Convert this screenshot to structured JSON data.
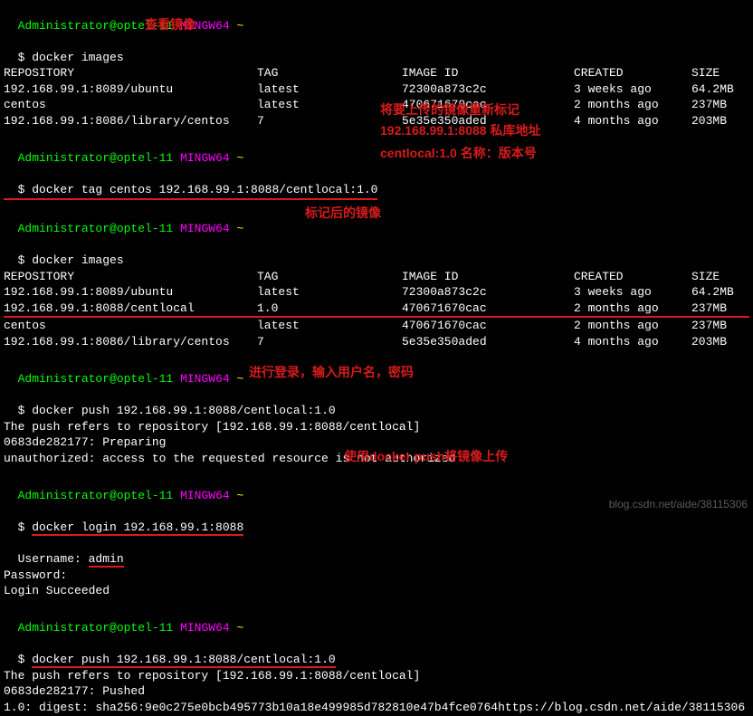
{
  "prompt": {
    "user_host": "Administrator@optel-11",
    "shell": "MINGW64",
    "cwd": "~",
    "symbol": "$ "
  },
  "cmd1": "docker images",
  "table1": {
    "headers": {
      "repo": "REPOSITORY",
      "tag": "TAG",
      "imgid": "IMAGE ID",
      "created": "CREATED",
      "size": "SIZE"
    },
    "rows": [
      {
        "repo": "192.168.99.1:8089/ubuntu",
        "tag": "latest",
        "imgid": "72300a873c2c",
        "created": "3 weeks ago",
        "size": "64.2MB"
      },
      {
        "repo": "centos",
        "tag": "latest",
        "imgid": "470671670cac",
        "created": "2 months ago",
        "size": "237MB"
      },
      {
        "repo": "192.168.99.1:8086/library/centos",
        "tag": "7",
        "imgid": "5e35e350aded",
        "created": "4 months ago",
        "size": "203MB"
      }
    ]
  },
  "cmd2": "docker tag centos 192.168.99.1:8088/centlocal:1.0",
  "cmd3": "docker images",
  "table2": {
    "headers": {
      "repo": "REPOSITORY",
      "tag": "TAG",
      "imgid": "IMAGE ID",
      "created": "CREATED",
      "size": "SIZE"
    },
    "rows": [
      {
        "repo": "192.168.99.1:8089/ubuntu",
        "tag": "latest",
        "imgid": "72300a873c2c",
        "created": "3 weeks ago",
        "size": "64.2MB"
      },
      {
        "repo": "192.168.99.1:8088/centlocal",
        "tag": "1.0",
        "imgid": "470671670cac",
        "created": "2 months ago",
        "size": "237MB"
      },
      {
        "repo": "centos",
        "tag": "latest",
        "imgid": "470671670cac",
        "created": "2 months ago",
        "size": "237MB"
      },
      {
        "repo": "192.168.99.1:8086/library/centos",
        "tag": "7",
        "imgid": "5e35e350aded",
        "created": "4 months ago",
        "size": "203MB"
      }
    ]
  },
  "cmd4": "docker push 192.168.99.1:8088/centlocal:1.0",
  "push1": {
    "l1": "The push refers to repository [192.168.99.1:8088/centlocal]",
    "l2": "0683de282177: Preparing",
    "l3": "unauthorized: access to the requested resource is not authorized"
  },
  "cmd5": "docker login 192.168.99.1:8088",
  "login": {
    "user_label": "Username: ",
    "user_value": "admin",
    "pass_label": "Password:",
    "ok": "Login Succeeded"
  },
  "cmd6": "docker push 192.168.99.1:8088/centlocal:1.0",
  "push2": {
    "l1": "The push refers to repository [192.168.99.1:8088/centlocal]",
    "l2": "0683de282177: Pushed",
    "l3": "1.0: digest: sha256:9e0c275e0bcb495773b10a18e499985d782810e47b4fce0764https://blog.csdn.net/aide/38115306"
  },
  "annot": {
    "a1": "查看镜像",
    "a2": "将要上传的镜像重新标记",
    "a3": "192.168.99.1:8088  私库地址",
    "a4": "centlocal:1.0  名称：版本号",
    "a5": "标记后的镜像",
    "a6": "进行登录，输入用户名，密码",
    "a7": "使用docker push将镜像上传"
  },
  "watermark": "blog.csdn.net/aide/38115306"
}
